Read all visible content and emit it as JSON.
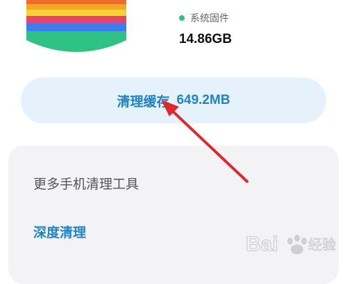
{
  "storage": {
    "legend_label": "系统固件",
    "legend_value": "14.86GB",
    "legend_dot_color": "#2ec27e"
  },
  "cache": {
    "label": "清理缓存",
    "size": "649.2MB"
  },
  "tools": {
    "title": "更多手机清理工具",
    "deep_clean": "深度清理"
  },
  "colors": {
    "accent": "#1f83c9",
    "button_bg": "#e5f2fb",
    "card_bg": "#f3f3f5",
    "arrow": "#e0272b"
  },
  "watermark": {
    "text": "Bai 经验"
  }
}
